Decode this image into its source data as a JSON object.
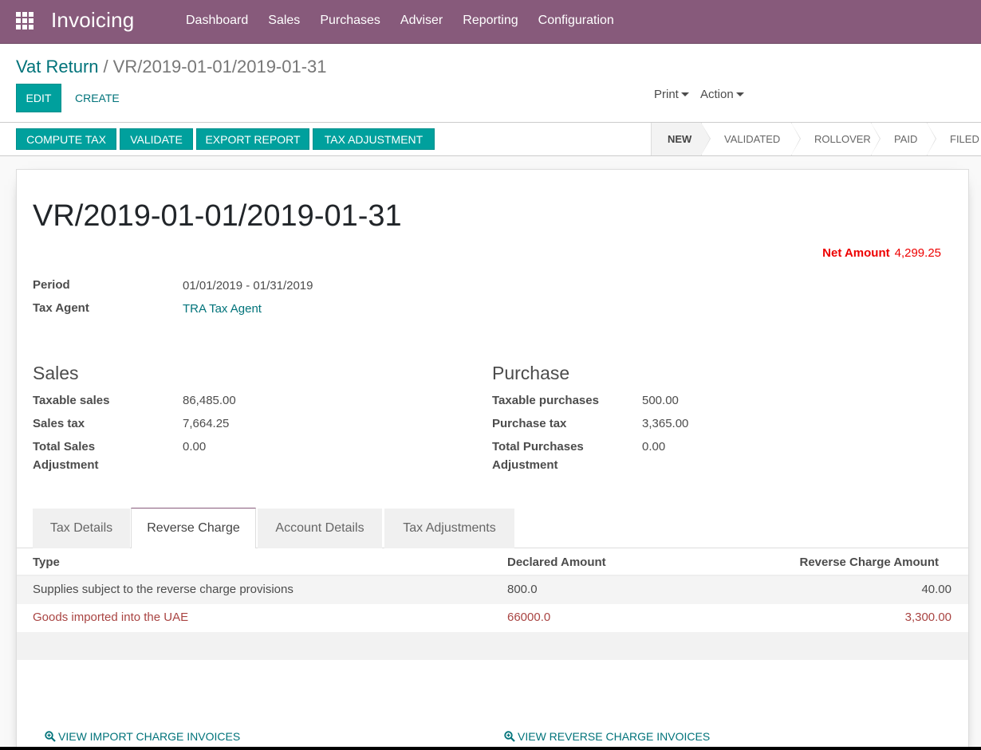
{
  "navbar": {
    "app_title": "Invoicing",
    "menu": [
      "Dashboard",
      "Sales",
      "Purchases",
      "Adviser",
      "Reporting",
      "Configuration"
    ],
    "color": "#875a7b"
  },
  "breadcrumb": {
    "parent": "Vat Return",
    "separator": "/",
    "current": "VR/2019-01-01/2019-01-31"
  },
  "control": {
    "edit_label": "EDIT",
    "create_label": "CREATE",
    "print_label": "Print",
    "action_label": "Action"
  },
  "actions": {
    "compute_tax": "COMPUTE TAX",
    "validate": "VALIDATE",
    "export_report": "EXPORT REPORT",
    "tax_adjustment": "TAX ADJUSTMENT"
  },
  "stages": [
    "NEW",
    "VALIDATED",
    "ROLLOVER",
    "PAID",
    "FILED"
  ],
  "current_stage": "NEW",
  "record": {
    "title": "VR/2019-01-01/2019-01-31",
    "net_amount_label": "Net Amount",
    "net_amount": "4,299.25",
    "period_label": "Period",
    "period": "01/01/2019 - 01/31/2019",
    "tax_agent_label": "Tax Agent",
    "tax_agent": "TRA Tax Agent"
  },
  "sales": {
    "title": "Sales",
    "taxable_label": "Taxable sales",
    "taxable": "86,485.00",
    "tax_label": "Sales tax",
    "tax": "7,664.25",
    "adj_label_1": "Total Sales",
    "adj_label_2": "Adjustment",
    "adjustment": "0.00"
  },
  "purchase": {
    "title": "Purchase",
    "taxable_label": "Taxable purchases",
    "taxable": "500.00",
    "tax_label": "Purchase tax",
    "tax": "3,365.00",
    "adj_label_1": "Total Purchases",
    "adj_label_2": "Adjustment",
    "adjustment": "0.00"
  },
  "tabs": [
    "Tax Details",
    "Reverse Charge",
    "Account Details",
    "Tax Adjustments"
  ],
  "active_tab": "Reverse Charge",
  "table": {
    "columns": [
      "Type",
      "Declared Amount",
      "Reverse Charge Amount"
    ],
    "rows": [
      {
        "type": "Supplies subject to the reverse charge provisions",
        "declared": "800.0",
        "reverse": "40.00",
        "color": "#4c4c4c"
      },
      {
        "type": "Goods imported into the UAE",
        "declared": "66000.0",
        "reverse": "3,300.00",
        "color": "#a94442"
      }
    ]
  },
  "links": {
    "import_invoices": "VIEW IMPORT CHARGE INVOICES",
    "reverse_invoices": "VIEW REVERSE CHARGE INVOICES"
  },
  "colors": {
    "primary": "#00a09d",
    "link": "#00737a",
    "danger": "#e00",
    "row_warning": "#a94442"
  }
}
